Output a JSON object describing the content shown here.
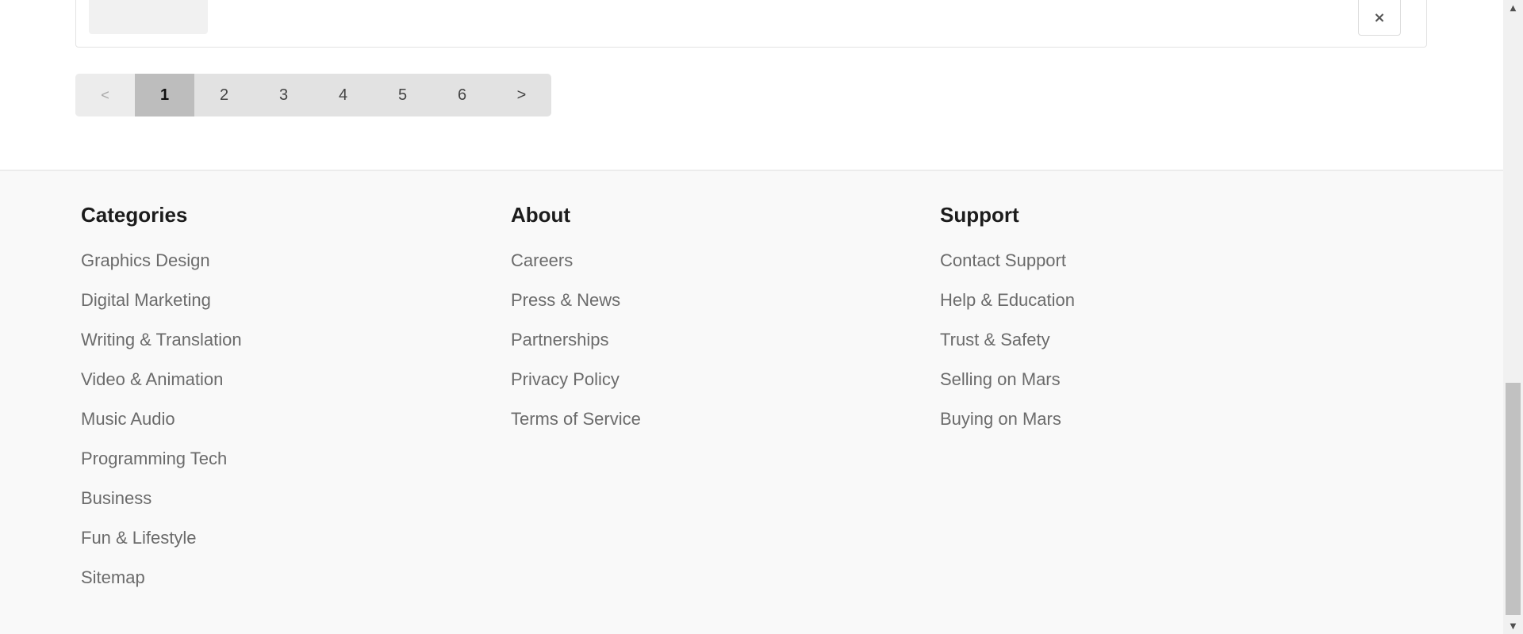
{
  "card": {
    "close_icon": "×"
  },
  "pagination": {
    "prev": "<",
    "pages": [
      "1",
      "2",
      "3",
      "4",
      "5",
      "6"
    ],
    "active_page": "1",
    "next": ">"
  },
  "footer": {
    "categories": {
      "title": "Categories",
      "items": [
        "Graphics Design",
        "Digital Marketing",
        "Writing & Translation",
        "Video & Animation",
        "Music Audio",
        "Programming Tech",
        "Business",
        "Fun & Lifestyle",
        "Sitemap"
      ]
    },
    "about": {
      "title": "About",
      "items": [
        "Careers",
        "Press & News",
        "Partnerships",
        "Privacy Policy",
        "Terms of Service"
      ]
    },
    "support": {
      "title": "Support",
      "items": [
        "Contact Support",
        "Help & Education",
        "Trust & Safety",
        "Selling on Mars",
        "Buying on Mars"
      ]
    }
  },
  "scrollbar": {
    "up_arrow": "▲",
    "down_arrow": "▼"
  },
  "colors": {
    "footer_background": "#f9f9f9",
    "pagination_active": "#bdbdbd",
    "pagination_background": "#e2e2e2",
    "link_text": "#6b6b6b",
    "heading_text": "#1c1c1c"
  }
}
